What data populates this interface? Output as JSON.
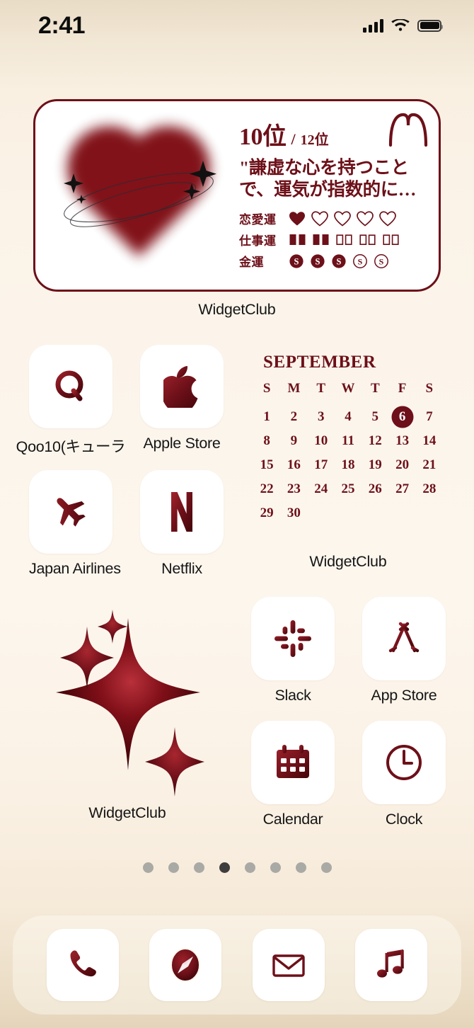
{
  "status_bar": {
    "time": "2:41",
    "signal_icon": "cellular-bars-icon",
    "wifi_icon": "wifi-icon",
    "battery_icon": "battery-full-icon"
  },
  "theme": {
    "accent": "#6d1019",
    "accent_deep": "#7d0b12",
    "background_top": "#e9dcc6",
    "background_mid": "#fdf6ed",
    "background_bottom": "#e4d4ba",
    "tile_background": "#ffffff",
    "label_color": "#151515"
  },
  "horoscope_widget": {
    "label": "WidgetClub",
    "zodiac_sign_icon": "aries-icon",
    "rank_value": "10位",
    "rank_separator": "/",
    "rank_total": "12位",
    "quote": "\"謙虚な心を持つことで、運気が指数的に…",
    "quote_line1": "\"謙虚な心を持つこと",
    "quote_line2": "で、運気が指数的に…",
    "art_icon": "blurred-heart-icon",
    "stats": [
      {
        "label": "恋愛運",
        "icon": "heart-icon",
        "filled": 1,
        "total": 5
      },
      {
        "label": "仕事運",
        "icon": "book-icon",
        "filled": 2,
        "total": 5
      },
      {
        "label": "金運",
        "icon": "coin-dollar-icon",
        "filled": 3,
        "total": 5
      }
    ]
  },
  "calendar_widget": {
    "label": "WidgetClub",
    "month": "SEPTEMBER",
    "weekdays": [
      "S",
      "M",
      "T",
      "W",
      "T",
      "F",
      "S"
    ],
    "lead_blanks": 0,
    "days": [
      1,
      2,
      3,
      4,
      5,
      6,
      7,
      8,
      9,
      10,
      11,
      12,
      13,
      14,
      15,
      16,
      17,
      18,
      19,
      20,
      21,
      22,
      23,
      24,
      25,
      26,
      27,
      28,
      29,
      30
    ],
    "today": 6
  },
  "sparkle_widget": {
    "label": "WidgetClub",
    "icon": "four-point-star-sparkle-icon"
  },
  "apps": [
    {
      "name": "Qoo10(キューラ",
      "icon": "qoo10-q-icon"
    },
    {
      "name": "Apple Store",
      "icon": "apple-logo-icon"
    },
    {
      "name": "Japan Airlines",
      "icon": "airplane-icon"
    },
    {
      "name": "Netflix",
      "icon": "netflix-n-icon"
    },
    {
      "name": "Slack",
      "icon": "slack-hash-icon"
    },
    {
      "name": "App Store",
      "icon": "app-store-a-icon"
    },
    {
      "name": "Calendar",
      "icon": "calendar-icon"
    },
    {
      "name": "Clock",
      "icon": "clock-icon"
    }
  ],
  "page_dots": {
    "count": 8,
    "active_index": 4
  },
  "dock": [
    {
      "name": "Phone",
      "icon": "phone-handset-icon"
    },
    {
      "name": "Safari",
      "icon": "safari-compass-icon"
    },
    {
      "name": "Mail",
      "icon": "envelope-icon"
    },
    {
      "name": "Music",
      "icon": "music-note-icon"
    }
  ]
}
